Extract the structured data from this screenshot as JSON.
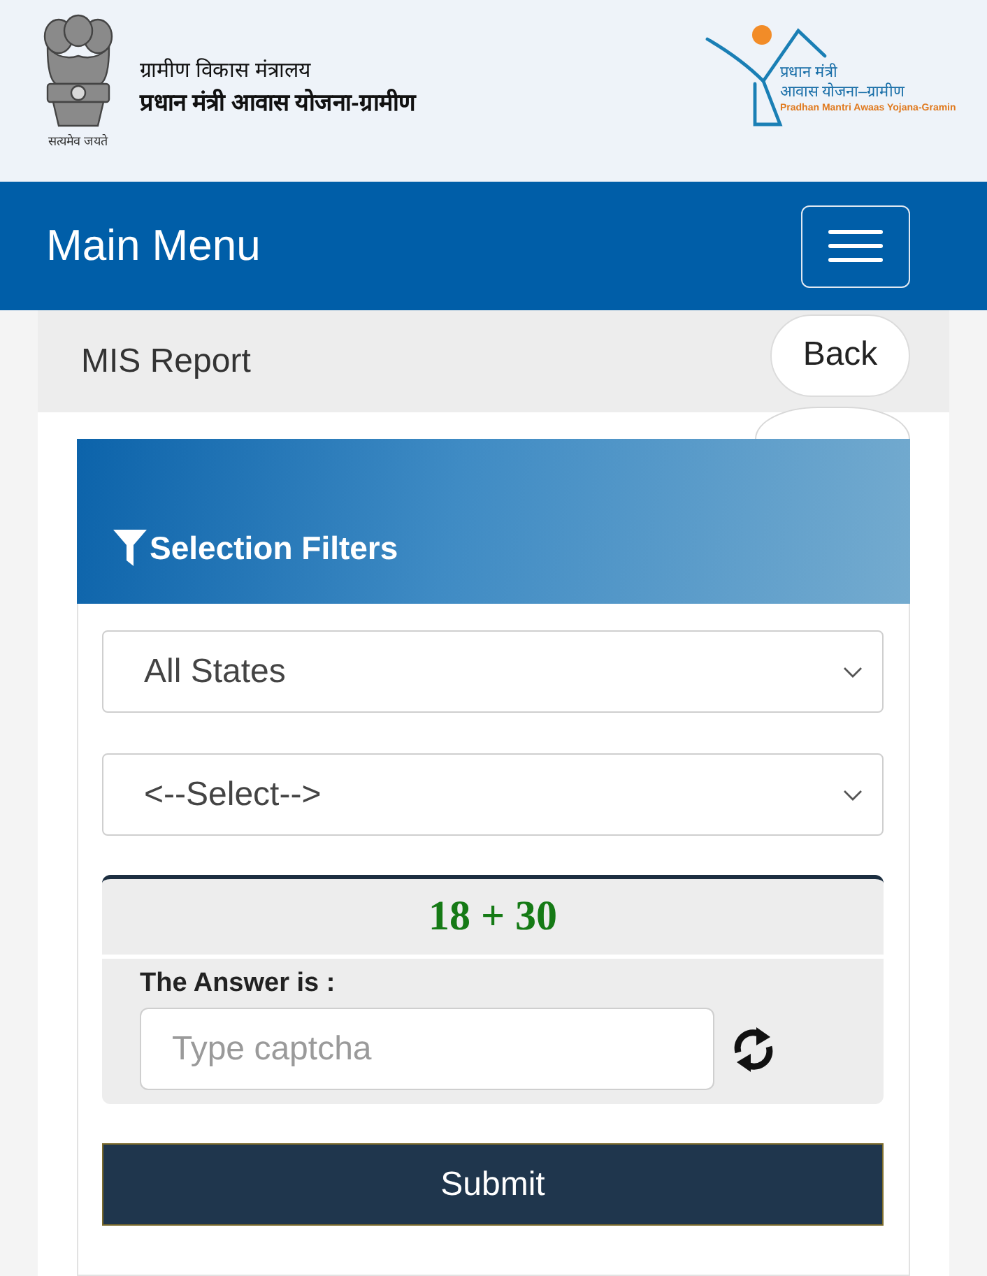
{
  "header": {
    "emblem_motto": "सत्यमेव जयते",
    "ministry": "ग्रामीण विकास मंत्रालय",
    "scheme": "प्रधान मंत्री आवास योजना-ग्रामीण",
    "logo": {
      "line_1": "प्रधान मंत्री",
      "line_2": "आवास योजना–ग्रामीण",
      "line_3": "Pradhan Mantri Awaas Yojana-Gramin"
    }
  },
  "navbar": {
    "title": "Main Menu"
  },
  "breadcrumb": {
    "title": "MIS Report",
    "back_button": "Back"
  },
  "filters": {
    "title": "Selection Filters",
    "selects": [
      {
        "value": "All States"
      },
      {
        "value": "<--Select-->"
      }
    ],
    "captcha": {
      "question": "18 + 30",
      "label": "The Answer is :",
      "placeholder": "Type captcha"
    },
    "submit": "Submit"
  }
}
